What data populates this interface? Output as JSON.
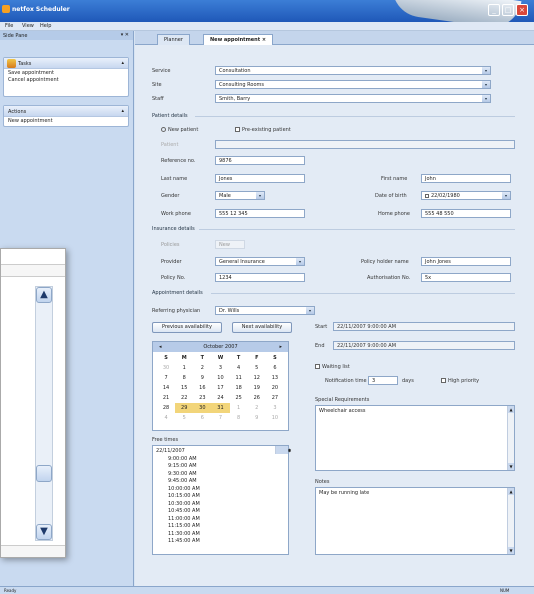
{
  "window": {
    "title": "netfox Scheduler",
    "min": "_",
    "max": "□",
    "close": "×"
  },
  "menu": [
    "File",
    "View",
    "Help"
  ],
  "leftpane": {
    "title": "Side Pane",
    "pin": "▾ ✕",
    "groups": [
      {
        "title": "Tasks",
        "items": [
          "Save appointment",
          "Cancel appointment"
        ]
      },
      {
        "title": "Actions",
        "items": [
          "New appointment"
        ]
      }
    ]
  },
  "tabs": [
    {
      "label": "Planner"
    },
    {
      "label": "New appointment"
    }
  ],
  "form": {
    "service_label": "Service",
    "service_value": "Consultation",
    "site_label": "Site",
    "site_value": "Consulting Rooms",
    "staff_label": "Staff",
    "staff_value": "Smith, Barry",
    "patient_section": "Patient details",
    "new_patient": "New patient",
    "existing_patient": "Pre-existing patient",
    "patient_label": "Patient",
    "ref_label": "Reference no.",
    "ref_value": "9876",
    "last_label": "Last name",
    "last_value": "Jones",
    "first_label": "First name",
    "first_value": "John",
    "gender_label": "Gender",
    "gender_value": "Male",
    "dob_label": "Date of birth",
    "dob_value": "22/02/1980",
    "work_label": "Work phone",
    "work_value": "555 12 345",
    "home_label": "Home phone",
    "home_value": "555 48 550",
    "insurance_section": "Insurance details",
    "policies_label": "Policies",
    "policies_value": "New",
    "provider_label": "Provider",
    "provider_value": "General Insurance",
    "holder_label": "Policy holder name",
    "holder_value": "John Jones",
    "policyno_label": "Policy No.",
    "policyno_value": "1234",
    "auth_label": "Authorisation No.",
    "auth_value": "5x",
    "appt_section": "Appointment details",
    "refphys_label": "Referring physician",
    "refphys_value": "Dr. Wills",
    "prev_btn": "Previous availability",
    "next_btn": "Next availability",
    "start_label": "Start",
    "start_value": "22/11/2007 9:00:00 AM",
    "end_label": "End",
    "end_value": "22/11/2007 9:00:00 AM",
    "waiting": "Waiting list",
    "notif_label": "Notification time",
    "notif_value": "3",
    "notif_unit": "days",
    "priority": "High priority",
    "special_label": "Special Requirements",
    "special_value": "Wheelchair access",
    "notes_label": "Notes",
    "notes_value": "May be running late",
    "free_label": "Free times"
  },
  "calendar": {
    "month": "October 2007",
    "prev": "◂",
    "next": "▸",
    "dow": [
      "S",
      "M",
      "T",
      "W",
      "T",
      "F",
      "S"
    ],
    "days": [
      {
        "d": "30",
        "o": true
      },
      {
        "d": "1"
      },
      {
        "d": "2"
      },
      {
        "d": "3"
      },
      {
        "d": "4"
      },
      {
        "d": "5"
      },
      {
        "d": "6"
      },
      {
        "d": "7"
      },
      {
        "d": "8"
      },
      {
        "d": "9"
      },
      {
        "d": "10"
      },
      {
        "d": "11"
      },
      {
        "d": "12"
      },
      {
        "d": "13"
      },
      {
        "d": "14"
      },
      {
        "d": "15"
      },
      {
        "d": "16"
      },
      {
        "d": "17"
      },
      {
        "d": "18"
      },
      {
        "d": "19"
      },
      {
        "d": "20"
      },
      {
        "d": "21"
      },
      {
        "d": "22"
      },
      {
        "d": "23"
      },
      {
        "d": "24"
      },
      {
        "d": "25"
      },
      {
        "d": "26"
      },
      {
        "d": "27"
      },
      {
        "d": "28"
      },
      {
        "d": "29",
        "s": true
      },
      {
        "d": "30",
        "s": true
      },
      {
        "d": "31",
        "s": true
      },
      {
        "d": "1",
        "o": true
      },
      {
        "d": "2",
        "o": true
      },
      {
        "d": "3",
        "o": true
      },
      {
        "d": "4",
        "o": true
      },
      {
        "d": "5",
        "o": true
      },
      {
        "d": "6",
        "o": true
      },
      {
        "d": "7",
        "o": true
      },
      {
        "d": "8",
        "o": true
      },
      {
        "d": "9",
        "o": true
      },
      {
        "d": "10",
        "o": true
      }
    ]
  },
  "free_times": [
    "22/11/2007",
    "9:00:00 AM",
    "9:15:00 AM",
    "9:30:00 AM",
    "9:45:00 AM",
    "10:00:00 AM",
    "10:15:00 AM",
    "10:30:00 AM",
    "10:45:00 AM",
    "11:00:00 AM",
    "11:15:00 AM",
    "11:30:00 AM",
    "11:45:00 AM"
  ],
  "status": {
    "left": "Ready",
    "right": "NUM"
  },
  "overlay": {
    "up": "▲",
    "down": "▼"
  }
}
